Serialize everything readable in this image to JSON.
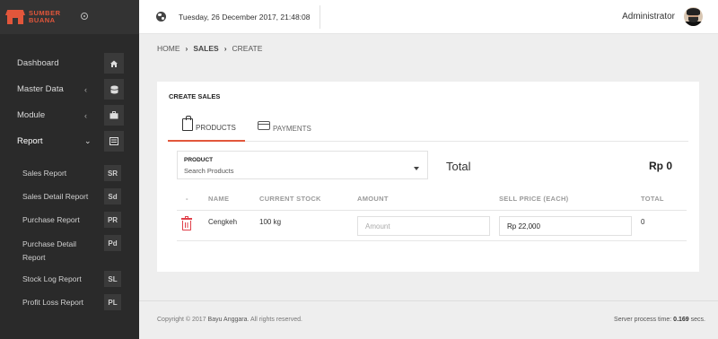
{
  "brand": {
    "line1": "SUMBER",
    "line2": "BUANA",
    "color": "#e2563b"
  },
  "sidebar": {
    "items": [
      {
        "label": "Dashboard",
        "icon": "home-icon"
      },
      {
        "label": "Master Data",
        "icon": "database-icon",
        "chevron": "‹"
      },
      {
        "label": "Module",
        "icon": "briefcase-icon",
        "chevron": "‹"
      },
      {
        "label": "Report",
        "icon": "list-icon",
        "chevron": "⌄",
        "active": true
      }
    ],
    "submenu": [
      {
        "label": "Sales Report",
        "badge": "SR"
      },
      {
        "label": "Sales Detail Report",
        "badge": "Sd"
      },
      {
        "label": "Purchase Report",
        "badge": "PR"
      },
      {
        "label": "Purchase Detail Report",
        "badge": "Pd"
      },
      {
        "label": "Stock Log Report",
        "badge": "SL"
      },
      {
        "label": "Profit Loss Report",
        "badge": "PL"
      }
    ]
  },
  "topbar": {
    "datetime": "Tuesday, 26 December 2017, 21:48:08",
    "user": "Administrator"
  },
  "breadcrumb": {
    "home": "HOME",
    "sep": "›",
    "sales": "SALES",
    "current": "CREATE"
  },
  "card": {
    "title": "CREATE SALES",
    "tabs": {
      "products": "PRODUCTS",
      "payments": "PAYMENTS"
    },
    "product": {
      "label": "PRODUCT",
      "placeholder": "Search Products"
    },
    "total_label": "Total",
    "total_value": "Rp 0",
    "columns": {
      "dash": "-",
      "name": "NAME",
      "stock": "CURRENT STOCK",
      "amount": "AMOUNT",
      "price": "SELL PRICE (EACH)",
      "total": "TOTAL"
    },
    "row": {
      "name": "Cengkeh",
      "stock": "100 kg",
      "amount_placeholder": "Amount",
      "price": "Rp 22,000",
      "total": "0"
    }
  },
  "footer": {
    "copyright_prefix": "Copyright © 2017",
    "author": "Bayu Anggara",
    "copyright_suffix": ". All rights reserved.",
    "process_label": "Server process time:",
    "process_value": "0.169",
    "process_unit": "secs."
  }
}
